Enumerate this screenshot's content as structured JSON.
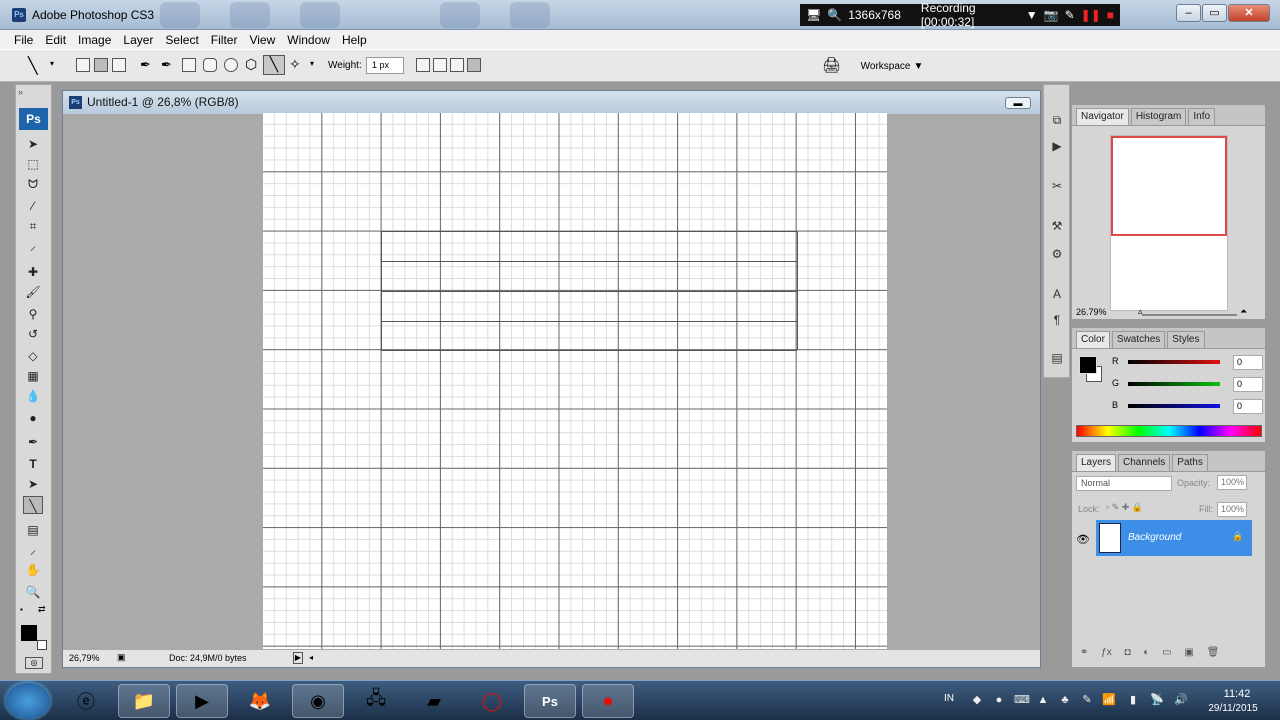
{
  "window": {
    "title": "Adobe Photoshop CS3",
    "app_icon": "Ps"
  },
  "recorder": {
    "resolution": "1366x768",
    "status": "Recording [00:00:32]"
  },
  "menu": [
    "File",
    "Edit",
    "Image",
    "Layer",
    "Select",
    "Filter",
    "View",
    "Window",
    "Help"
  ],
  "options": {
    "weight_label": "Weight:",
    "weight_value": "1 px",
    "workspace_label": "Workspace"
  },
  "toolbox": {
    "badge": "Ps"
  },
  "document": {
    "title": "Untitled-1 @ 26,8% (RGB/8)",
    "zoom": "26,79%",
    "doc_info": "Doc: 24,9M/0 bytes"
  },
  "navigator": {
    "tabs": [
      "Navigator",
      "Histogram",
      "Info"
    ],
    "zoom": "26.79%"
  },
  "color": {
    "tabs": [
      "Color",
      "Swatches",
      "Styles"
    ],
    "channels": [
      {
        "label": "R",
        "value": "0",
        "color": "#cc1010"
      },
      {
        "label": "G",
        "value": "0",
        "color": "#10a010"
      },
      {
        "label": "B",
        "value": "0",
        "color": "#1010cc"
      }
    ]
  },
  "layers": {
    "tabs": [
      "Layers",
      "Channels",
      "Paths"
    ],
    "blend_mode": "Normal",
    "opacity_label": "Opacity:",
    "opacity": "100%",
    "lock_label": "Lock:",
    "fill_label": "Fill:",
    "fill": "100%",
    "layer_name": "Background"
  },
  "taskbar": {
    "lang": "IN",
    "time": "11:42",
    "date": "29/11/2015"
  }
}
